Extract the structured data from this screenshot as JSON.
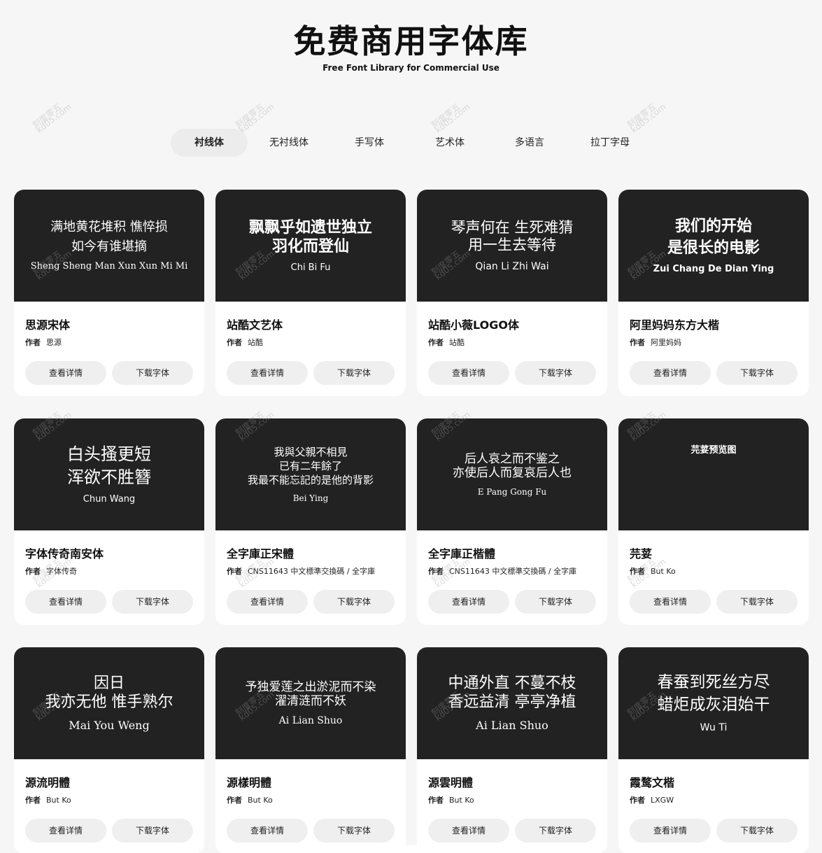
{
  "header": {
    "title": "免费商用字体库",
    "subtitle": "Free Font Library for Commercial Use"
  },
  "tabs": [
    {
      "label": "衬线体",
      "active": true
    },
    {
      "label": "无衬线体",
      "active": false
    },
    {
      "label": "手写体",
      "active": false
    },
    {
      "label": "艺术体",
      "active": false
    },
    {
      "label": "多语言",
      "active": false
    },
    {
      "label": "拉丁字母",
      "active": false
    }
  ],
  "buttons": {
    "detail": "查看详情",
    "download": "下载字体"
  },
  "author_label": "作者",
  "cards": [
    {
      "preview": {
        "line1": "满地黄花堆积 憔悴损",
        "line2": "如今有谁堪摘",
        "sub": "Sheng Sheng Man Xun Xun Mi Mi"
      },
      "name": "思源宋体",
      "author": "思源"
    },
    {
      "preview": {
        "line1": "飘飘乎如遗世独立",
        "line2": "羽化而登仙",
        "sub": "Chi Bi Fu"
      },
      "name": "站酷文艺体",
      "author": "站酷"
    },
    {
      "preview": {
        "line1": "琴声何在 生死难猜",
        "line2": "用一生去等待",
        "sub": "Qian Li Zhi Wai"
      },
      "name": "站酷小薇LOGO体",
      "author": "站酷"
    },
    {
      "preview": {
        "line1": "我们的开始",
        "line2": "是很长的电影",
        "sub": "Zui Chang De Dian Ying"
      },
      "name": "阿里妈妈东方大楷",
      "author": "阿里妈妈"
    },
    {
      "preview": {
        "line1": "白头搔更短",
        "line2": "浑欲不胜簪",
        "sub": "Chun Wang"
      },
      "name": "字体传奇南安体",
      "author": "字体传奇"
    },
    {
      "preview": {
        "line1": "我與父親不相見",
        "line2": "已有二年餘了",
        "line3": "我最不能忘記的是他的背影",
        "sub": "Bei Ying"
      },
      "name": "全字庫正宋體",
      "author": "CNS11643 中文標準交換碼 / 全字庫"
    },
    {
      "preview": {
        "line1": "后人哀之而不鉴之",
        "line2": "亦使后人而复哀后人也",
        "sub": "E Pang Gong Fu"
      },
      "name": "全字庫正楷體",
      "author": "CNS11643 中文標準交換碼 / 全字庫"
    },
    {
      "preview": {
        "line1": "芫荽预览图",
        "line2": "",
        "sub": ""
      },
      "name": "芫荽",
      "author": "But Ko"
    },
    {
      "preview": {
        "line1": "因日",
        "line2": "我亦无他 惟手熟尔",
        "sub": "Mai You Weng"
      },
      "name": "源流明體",
      "author": "But Ko"
    },
    {
      "preview": {
        "line1": "予独爱莲之出淤泥而不染",
        "line2": "濯清涟而不妖",
        "sub": "Ai Lian Shuo"
      },
      "name": "源樣明體",
      "author": "But Ko"
    },
    {
      "preview": {
        "line1": "中通外直 不蔓不枝",
        "line2": "香远益清 亭亭净植",
        "sub": "Ai Lian Shuo"
      },
      "name": "源雲明體",
      "author": "But Ko"
    },
    {
      "preview": {
        "line1": "春蚕到死丝方尽",
        "line2": "蜡炬成灰泪始干",
        "sub": "Wu Ti"
      },
      "name": "霞鹜文楷",
      "author": "LXGW"
    }
  ],
  "watermark": {
    "text": "刻度零五",
    "url": "kd05.com"
  }
}
